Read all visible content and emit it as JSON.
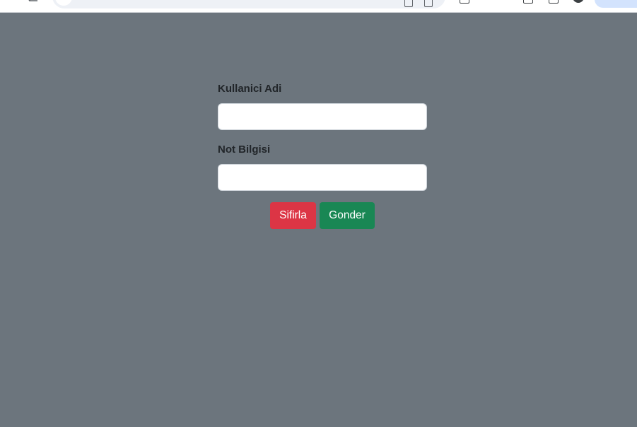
{
  "form": {
    "username_label": "Kullanici Adi",
    "username_value": "",
    "note_label": "Not Bilgisi",
    "note_value": "",
    "reset_label": "Sifirla",
    "submit_label": "Gonder"
  },
  "colors": {
    "page_background": "#6c757d",
    "reset_button": "#dc3545",
    "submit_button": "#198754"
  },
  "browser_icons": [
    "back-icon",
    "site-info-icon",
    "install-icon",
    "bookmark-icon",
    "extensions-icon",
    "tab-search-icon",
    "profile-icon"
  ]
}
